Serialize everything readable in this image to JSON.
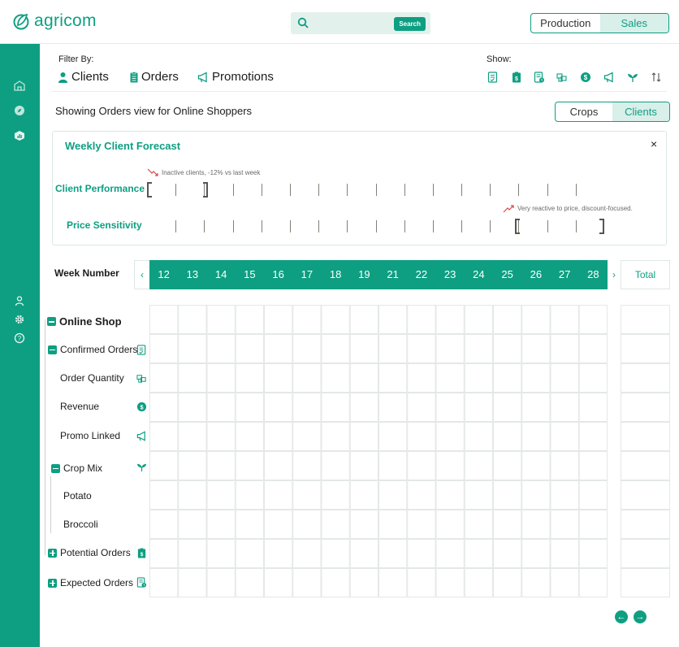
{
  "app": {
    "logo_text": "agricom"
  },
  "search": {
    "button_label": "Search",
    "placeholder": ""
  },
  "mode_toggle": {
    "options": [
      "Production",
      "Sales"
    ],
    "active": "Sales"
  },
  "sidebar": {
    "icons": [
      "barn-icon",
      "compass-icon",
      "analytics-icon",
      "user-icon",
      "gear-icon",
      "help-icon"
    ]
  },
  "filter": {
    "label": "Filter By:",
    "items": [
      {
        "label": "Clients",
        "icon": "person-icon"
      },
      {
        "label": "Orders",
        "icon": "clipboard-icon"
      },
      {
        "label": "Promotions",
        "icon": "megaphone-icon"
      }
    ]
  },
  "show": {
    "label": "Show:",
    "icons": [
      "confirmed-orders-icon",
      "potential-orders-icon",
      "expected-orders-icon",
      "quantity-icon",
      "revenue-icon",
      "promo-icon",
      "crop-icon",
      "sort-icon"
    ]
  },
  "view": {
    "text": "Showing Orders view for Online Shoppers",
    "toggle": [
      "Crops",
      "Clients"
    ],
    "active": "Clients"
  },
  "forecast": {
    "title": "Weekly Client Forecast",
    "close": "×",
    "rows": [
      {
        "label": "Client Performance",
        "note": "Inactive clients, -12% vs last week",
        "trend": "down"
      },
      {
        "label": "Price Sensitivity",
        "note": "Very reactive to price, discount-focused.",
        "trend": "up"
      }
    ]
  },
  "weeks": {
    "label": "Week Number",
    "prev": "‹",
    "next": "›",
    "numbers": [
      "12",
      "13",
      "14",
      "15",
      "16",
      "17",
      "18",
      "19",
      "21",
      "22",
      "23",
      "24",
      "25",
      "26",
      "27",
      "28"
    ],
    "total_label": "Total"
  },
  "tree": {
    "online_shop": "Online Shop",
    "confirmed_orders": "Confirmed Orders",
    "order_quantity": "Order Quantity",
    "revenue": "Revenue",
    "promo_linked": "Promo Linked",
    "crop_mix": "Crop Mix",
    "potato": "Potato",
    "broccoli": "Broccoli",
    "potential_orders": "Potential Orders",
    "expected_orders": "Expected Orders"
  },
  "colors": {
    "accent": "#0e9f82",
    "accent_light": "#d9efe9"
  }
}
